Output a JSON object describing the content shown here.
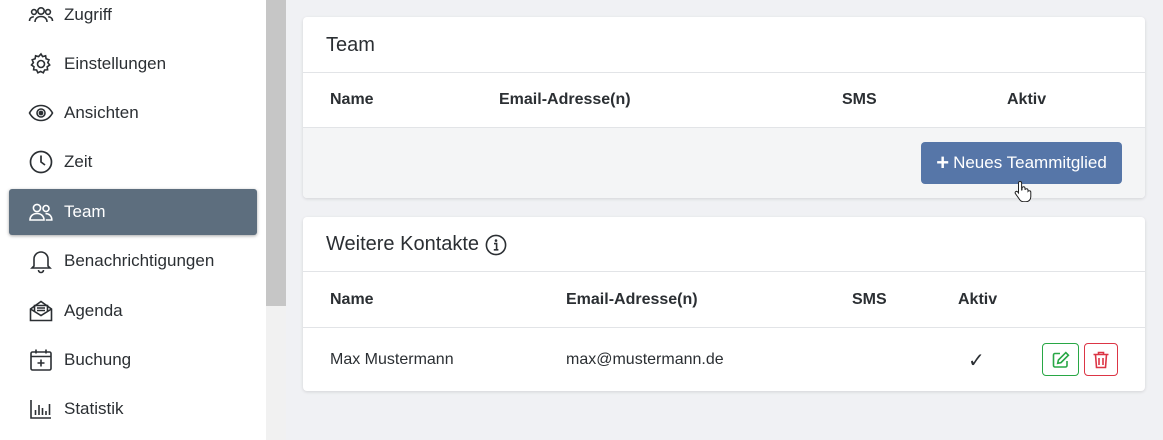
{
  "sidebar": {
    "items": [
      {
        "label": "Zugriff",
        "icon": "users-icon"
      },
      {
        "label": "Einstellungen",
        "icon": "gear-icon"
      },
      {
        "label": "Ansichten",
        "icon": "eye-icon"
      },
      {
        "label": "Zeit",
        "icon": "clock-icon"
      },
      {
        "label": "Team",
        "icon": "team-icon",
        "active": true
      },
      {
        "label": "Benachrichtigungen",
        "icon": "bell-icon"
      },
      {
        "label": "Agenda",
        "icon": "envelope-open-icon"
      },
      {
        "label": "Buchung",
        "icon": "calendar-plus-icon"
      },
      {
        "label": "Statistik",
        "icon": "bar-chart-icon"
      }
    ]
  },
  "team_card": {
    "title": "Team",
    "columns": {
      "name": "Name",
      "email": "Email-Adresse(n)",
      "sms": "SMS",
      "active": "Aktiv"
    },
    "add_button": "Neues Teammitglied"
  },
  "contacts_card": {
    "title": "Weitere Kontakte",
    "info_icon": "info-circle-icon",
    "columns": {
      "name": "Name",
      "email": "Email-Adresse(n)",
      "sms": "SMS",
      "active": "Aktiv"
    },
    "rows": [
      {
        "name": "Max Mustermann",
        "email": "max@mustermann.de",
        "sms": "",
        "active": "✓"
      }
    ]
  },
  "colors": {
    "active_nav": "#5d6e7e",
    "primary_button": "#5676a8",
    "edit": "#28a745",
    "delete": "#dc3545"
  }
}
